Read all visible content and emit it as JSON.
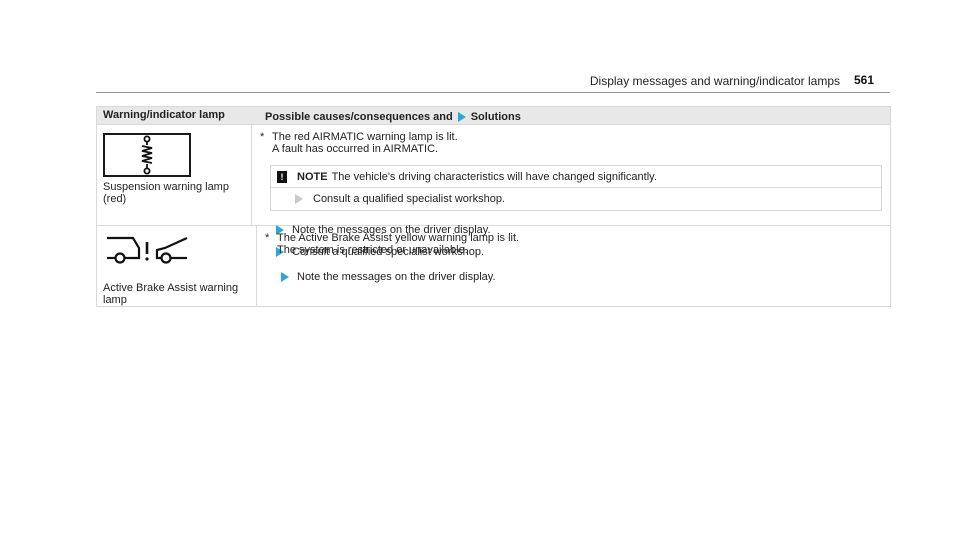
{
  "header": {
    "title": "Display messages and warning/indicator lamps",
    "page_number": "561"
  },
  "table": {
    "col1_header": "Warning/indicator lamp",
    "col2_header_a": "Possible causes/consequences and",
    "col2_header_b": "Solutions",
    "rows": [
      {
        "icon": "suspension-spring-icon",
        "lamp_label_1": "Suspension warning lamp",
        "lamp_label_2": "(red)",
        "cause_star": "*",
        "cause_line_1": "The red AIRMATIC warning lamp is lit.",
        "cause_line_2": "A fault has occurred in AIRMATIC.",
        "note_badge": "!",
        "note_label": "NOTE",
        "note_text": "The vehicle's driving characteristics will have changed significantly.",
        "note_step": "Consult a qualified specialist workshop.",
        "step_1": "Note the messages on the driver display.",
        "step_2": "Consult a qualified specialist workshop."
      },
      {
        "icon": "active-brake-assist-icon",
        "lamp_label_1": "Active Brake Assist warning",
        "lamp_label_2": "lamp",
        "cause_star": "*",
        "cause_line_1": "The Active Brake Assist yellow warning lamp is lit.",
        "cause_line_2": "The system is restricted or unavailable.",
        "step_1": "Note the messages on the driver display."
      }
    ]
  },
  "colors": {
    "accent": "#2aa7d6",
    "header_bg": "#e8e8e8",
    "border": "#d9d9d9"
  }
}
